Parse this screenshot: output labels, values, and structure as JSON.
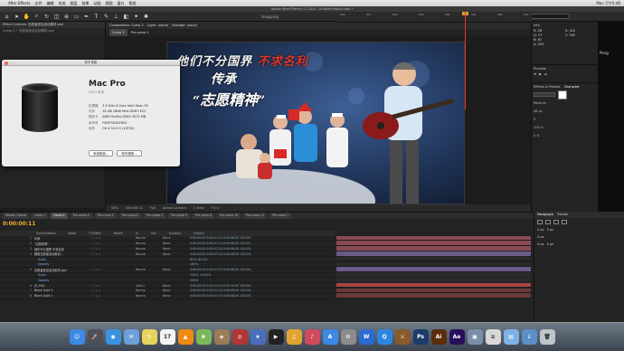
{
  "menubar": {
    "apple": "",
    "app": "After Effects",
    "items": [
      "文件",
      "编辑",
      "合成",
      "图层",
      "效果",
      "动画",
      "视图",
      "窗口",
      "帮助"
    ],
    "right": [
      "Mon 下午5:46"
    ]
  },
  "ae_title": "Adobe After Effects CC 2014 - Untitled Project.aep *",
  "toolbar": {
    "snapping": "Snapping",
    "workspace_label": "Workspace:",
    "workspace_value": "Standard",
    "search_placeholder": "Search Help"
  },
  "project_panel": {
    "tab1": "Effect Controls: 志愿者参加活动素材.psd",
    "tab2": "Comp 2 • 志愿者参加活动素材.psd"
  },
  "comp_panel": {
    "tabs": [
      "Composition: Comp 2",
      "Layer: (none)",
      "Footage: (none)"
    ],
    "subtabs": [
      "Comp 2",
      "Pre-comp 4"
    ],
    "footer": [
      "50%",
      "0:00:00:11",
      "Full",
      "Active Camera",
      "1 View",
      "+0.0"
    ]
  },
  "poster": {
    "line1_white": "他们不分国界",
    "line1_red": "不求名利",
    "line2": "传承",
    "line3_quote_open": "“",
    "line3": "志愿精神",
    "line3_quote_close": "”"
  },
  "about_dialog": {
    "title": "关于本机",
    "model": "Mac Pro",
    "year": "2013 年末",
    "specs": [
      {
        "k": "处理器",
        "v": "3.5 GHz 6-Core Intel Xeon E5"
      },
      {
        "k": "内存",
        "v": "16 GB 1866 MHz DDR3 ECC"
      },
      {
        "k": "图形卡",
        "v": "AMD FirePro D500 3072 MB"
      },
      {
        "k": "序列号",
        "v": "F5KP70GDF693"
      },
      {
        "k": "软件",
        "v": "OS X 10.9.5 (13F34)"
      }
    ],
    "buttons": [
      "系统报告...",
      "软件更新..."
    ]
  },
  "info_panel": {
    "tab": "Info",
    "values": [
      [
        "R: 28",
        "X: 412"
      ],
      [
        "G: 37",
        "Y: 746"
      ],
      [
        "B: 67",
        ""
      ],
      [
        "A: 255",
        ""
      ]
    ]
  },
  "preview_panel": {
    "tab": "Preview"
  },
  "char_panel": {
    "tabs": [
      "Effects & Presets",
      "Character"
    ],
    "font": "Medium",
    "size": "46 px",
    "tracking": "0",
    "scale": "100 %",
    "pct": "0 %"
  },
  "far_right_text": "Peng",
  "timeline": {
    "timecode": "0:00:00:11",
    "tabs": [
      "Render Queue",
      "Comp 1",
      "Comp 2",
      "Pre-comp 4",
      "Pre-comp 1",
      "Pre-comp 6",
      "Pre-comp 3",
      "Pre-comp 5",
      "Pre-comp 8",
      "Pre-comp 10",
      "Pre-comp 11",
      "Pre-comp 7"
    ],
    "header": [
      "Source Name",
      "Mode",
      "T TrkMat",
      "Parent",
      "In",
      "Out",
      "Duration",
      "Stretch"
    ],
    "ruler": [
      "00s",
      "01s",
      "02s",
      "03s",
      "04s",
      "05s",
      "06s",
      "07s"
    ],
    "layers": [
      {
        "num": "1",
        "name": "传承",
        "mode": "Norma",
        "parent": "None",
        "times": "0:00:00:00   0:00:07:24   0:00:08:00   100.0%",
        "sub": false
      },
      {
        "num": "2",
        "name": "\"志愿精神\"",
        "mode": "Norma",
        "parent": "None",
        "times": "0:00:00:00   0:00:07:24   0:00:08:00   100.0%",
        "sub": false
      },
      {
        "num": "3",
        "name": "他们不分国界 不求名利",
        "mode": "Norma",
        "parent": "None",
        "times": "0:00:00:00   0:00:07:24   0:00:08:00   100.0%",
        "sub": false
      },
      {
        "num": "4",
        "name": "随着志愿者活动参加...",
        "mode": "Norma",
        "parent": "None",
        "times": "0:00:00:00   0:00:07:24   0:00:08:00   100.0%",
        "sub": false
      },
      {
        "num": "",
        "name": "Scale",
        "mode": "",
        "parent": "",
        "times": "83.0, 83.0%",
        "sub": true
      },
      {
        "num": "",
        "name": "Opacity",
        "mode": "",
        "parent": "",
        "times": "100%",
        "sub": true
      },
      {
        "num": "5",
        "name": "志愿者参加活动素材.psd",
        "mode": "Norma",
        "parent": "None",
        "times": "0:00:00:00   0:00:07:24   0:00:08:00   100.0%",
        "sub": false
      },
      {
        "num": "",
        "name": "Scale",
        "mode": "",
        "parent": "",
        "times": "119.0, 119.0%",
        "sub": true
      },
      {
        "num": "",
        "name": "Opacity",
        "mode": "",
        "parent": "",
        "times": "100%",
        "sub": true
      },
      {
        "num": "6",
        "name": "[S_MO]",
        "mode": "Soft Li",
        "parent": "None",
        "times": "0:00:00:00   0:00:13:14   0:00:14:00   100.0%",
        "sub": false
      },
      {
        "num": "7",
        "name": "Black Solid 3",
        "mode": "Norma",
        "parent": "None",
        "times": "0:00:00:00   0:00:07:24   0:00:08:00   100.0%",
        "sub": false
      },
      {
        "num": "8",
        "name": "Black Solid 1",
        "mode": "Norma",
        "parent": "None",
        "times": "0:00:00:00   0:00:07:24   0:00:08:00   100.0%",
        "sub": false
      }
    ],
    "track_colors": [
      "#8a4a55",
      "#8a4a55",
      "#8a4a55",
      "#6b5a8a",
      "#2a2a2a",
      "#2a2a2a",
      "#6b5a8a",
      "#2a2a2a",
      "#2a2a2a",
      "#a44",
      "#6b3a3a",
      "#6b3a3a"
    ]
  },
  "para_panel": {
    "tabs": [
      "Paragraph",
      "Tracker"
    ],
    "vals": [
      "0 px",
      "0 px",
      "0 px",
      "0 px",
      "0 px"
    ]
  },
  "dock": {
    "icons": [
      {
        "name": "finder-icon",
        "label": "☺",
        "color": "#3d8ae6"
      },
      {
        "name": "launchpad-icon",
        "label": "🚀",
        "color": "#4a4f59"
      },
      {
        "name": "safari-icon",
        "label": "◉",
        "color": "#3b93e0"
      },
      {
        "name": "mail-icon",
        "label": "✉",
        "color": "#6ba0d8"
      },
      {
        "name": "notes-icon",
        "label": "✎",
        "color": "#e8d35d"
      },
      {
        "name": "calendar-icon",
        "label": "17",
        "color": "#f4f4f4"
      },
      {
        "name": "vlc-icon",
        "label": "▲",
        "color": "#f08a12"
      },
      {
        "name": "photos-icon",
        "label": "❀",
        "color": "#7ab85b"
      },
      {
        "name": "preview-icon",
        "label": "◈",
        "color": "#9c7b55"
      },
      {
        "name": "photobooth-icon",
        "label": "◎",
        "color": "#b23434"
      },
      {
        "name": "imovie-icon",
        "label": "★",
        "color": "#4b6ebc"
      },
      {
        "name": "clapper-icon",
        "label": "▶",
        "color": "#222"
      },
      {
        "name": "garageband-icon",
        "label": "♫",
        "color": "#e0a431"
      },
      {
        "name": "music-icon",
        "label": "♪",
        "color": "#d04a5e"
      },
      {
        "name": "appstore-icon",
        "label": "A",
        "color": "#3d8ae6"
      },
      {
        "name": "settings-icon",
        "label": "⚙",
        "color": "#8c8c8c"
      },
      {
        "name": "word-icon",
        "label": "W",
        "color": "#2b6cd1"
      },
      {
        "name": "qq-icon",
        "label": "Q",
        "color": "#2d86e0"
      },
      {
        "name": "game-icon",
        "label": "⚔",
        "color": "#8a5a2b"
      },
      {
        "name": "photoshop-icon",
        "label": "Ps",
        "color": "#1c3b6a"
      },
      {
        "name": "illustrator-icon",
        "label": "Ai",
        "color": "#5a2c0a"
      },
      {
        "name": "aftereffects-icon",
        "label": "Ae",
        "color": "#27105a"
      },
      {
        "name": "photo-icon",
        "label": "▣",
        "color": "#7a8ea8"
      },
      {
        "name": "document-icon",
        "label": "≡",
        "color": "#d8d8d8"
      },
      {
        "name": "folder-icon",
        "label": "▤",
        "color": "#7fb2e6"
      },
      {
        "name": "downloads-icon",
        "label": "↓",
        "color": "#5c8fc7"
      },
      {
        "name": "trash-icon",
        "label": "🗑",
        "color": "#bfc5cc"
      }
    ]
  }
}
